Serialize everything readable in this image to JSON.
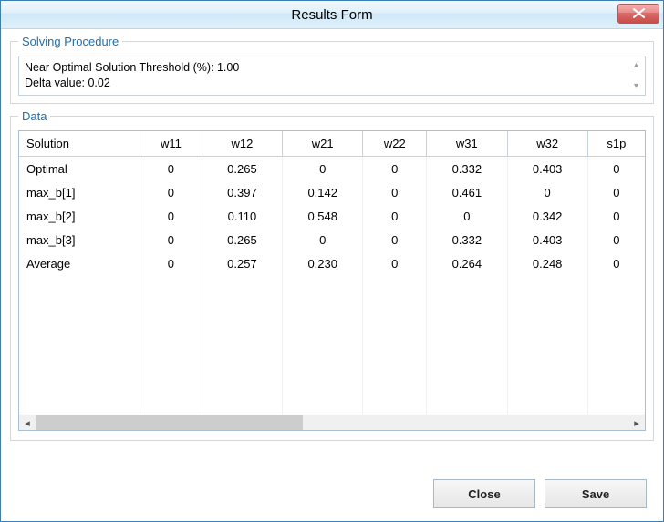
{
  "window": {
    "title": "Results Form"
  },
  "solving": {
    "legend": "Solving Procedure",
    "line1": "Near Optimal Solution Threshold (%): 1.00",
    "line2": "Delta value: 0.02"
  },
  "data_group": {
    "legend": "Data"
  },
  "buttons": {
    "close": "Close",
    "save": "Save"
  },
  "chart_data": {
    "type": "table",
    "columns": [
      "Solution",
      "w11",
      "w12",
      "w21",
      "w22",
      "w31",
      "w32",
      "s1p"
    ],
    "rows": [
      {
        "label": "Optimal",
        "values": [
          "0",
          "0.265",
          "0",
          "0",
          "0.332",
          "0.403",
          "0"
        ]
      },
      {
        "label": "max_b[1]",
        "values": [
          "0",
          "0.397",
          "0.142",
          "0",
          "0.461",
          "0",
          "0"
        ]
      },
      {
        "label": "max_b[2]",
        "values": [
          "0",
          "0.110",
          "0.548",
          "0",
          "0",
          "0.342",
          "0"
        ]
      },
      {
        "label": "max_b[3]",
        "values": [
          "0",
          "0.265",
          "0",
          "0",
          "0.332",
          "0.403",
          "0"
        ]
      },
      {
        "label": "Average",
        "values": [
          "0",
          "0.257",
          "0.230",
          "0",
          "0.264",
          "0.248",
          "0"
        ]
      }
    ]
  }
}
